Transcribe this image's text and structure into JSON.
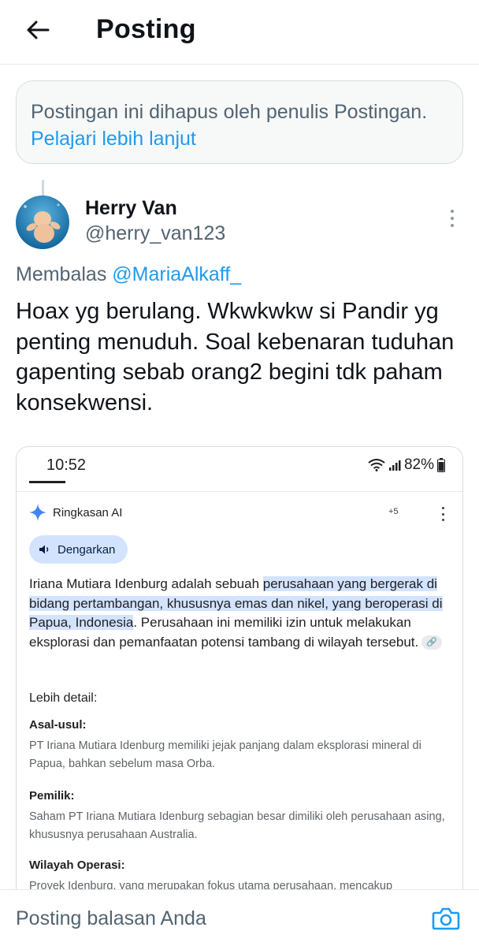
{
  "header": {
    "title": "Posting",
    "back_icon": "arrow-left-icon"
  },
  "deleted_notice": {
    "text": "Postingan ini dihapus oleh penulis Postingan.",
    "link": "Pelajari lebih lanjut"
  },
  "post": {
    "author_name": "Herry Van",
    "author_handle": "@herry_van123",
    "reply_prefix": "Membalas",
    "reply_mention": "@MariaAlkaff_",
    "text": "Hoax yg berulang. Wkwkwkw si Pandir yg penting menuduh. Soal kebenaran tuduhan gapenting sebab orang2 begini tdk paham konsekwensi."
  },
  "media": {
    "time": "10:52",
    "battery": "82%",
    "ai_title": "Ringkasan AI",
    "plus_count": "+5",
    "listen_label": "Dengarkan",
    "para_part1": "Iriana Mutiara Idenburg adalah sebuah ",
    "para_highlight": "perusahaan yang bergerak di bidang pertambangan, khususnya emas dan nikel, yang beroperasi di Papua, Indonesia",
    "para_part2": ". Perusahaan ini memiliki izin untuk melakukan eksplorasi dan pemanfaatan potensi tambang di wilayah tersebut.",
    "detail_heading": "Lebih detail:",
    "sections": [
      {
        "title": "Asal-usul:",
        "body": "PT Iriana Mutiara Idenburg memiliki jejak panjang dalam eksplorasi mineral di Papua, bahkan sebelum masa Orba."
      },
      {
        "title": "Pemilik:",
        "body": "Saham PT Iriana Mutiara Idenburg sebagian besar dimiliki oleh perusahaan asing, khususnya perusahaan Australia."
      },
      {
        "title": "Wilayah Operasi:",
        "body": "Proyek Idenburg, yang merupakan fokus utama perusahaan, mencakup"
      }
    ]
  },
  "reply_bar": {
    "placeholder": "Posting balasan Anda"
  },
  "colors": {
    "accent": "#1d9bf0",
    "secondary_text": "#536471",
    "highlight": "#d3e3fd"
  }
}
